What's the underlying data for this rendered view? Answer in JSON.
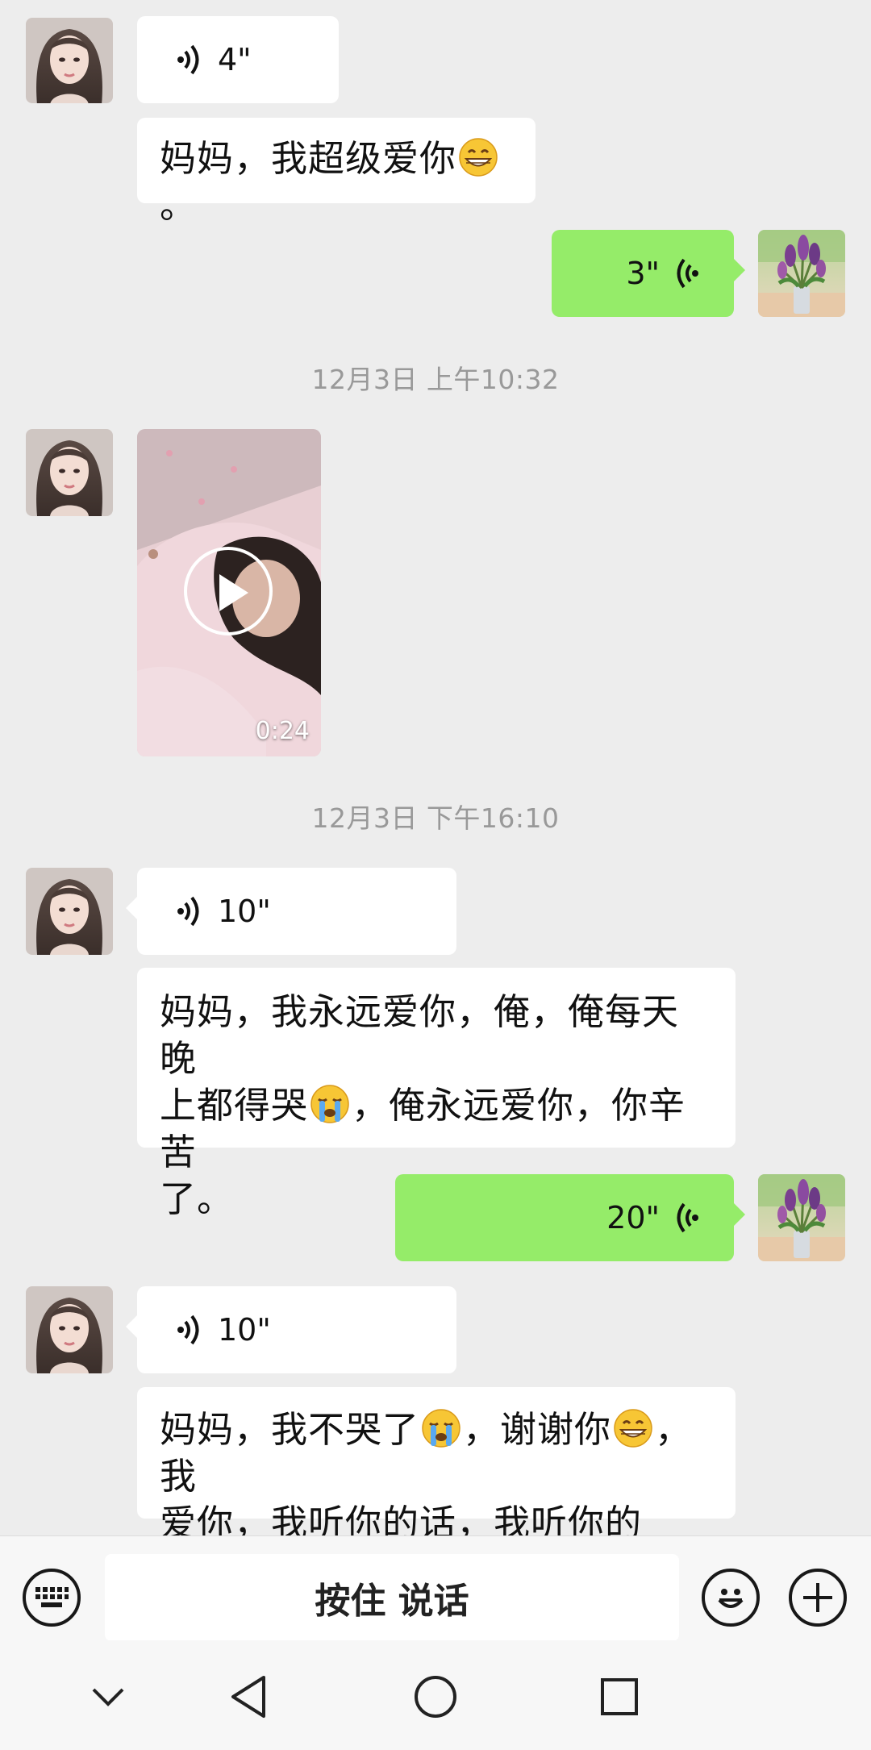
{
  "messages": {
    "m1_voice": {
      "duration": "4\""
    },
    "m2_text": {
      "before_emoji": "妈妈，我超级爱你",
      "emoji": "grinning-face-emoji",
      "after_emoji": "。"
    },
    "m3_voice_out": {
      "duration": "3\""
    },
    "ts1": "12月3日 上午10:32",
    "m4_video": {
      "duration": "0:24"
    },
    "ts2": "12月3日 下午16:10",
    "m5_voice": {
      "duration": "10\""
    },
    "m6_text": {
      "line1": "妈妈，我永远爱你，俺，俺每天晚",
      "line2_a": "上都得哭",
      "emoji": "loudly-crying-face-emoji",
      "line2_b": "，俺永远爱你，你辛苦",
      "line3": "了。"
    },
    "m7_voice_out": {
      "duration": "20\""
    },
    "m8_voice": {
      "duration": "10\""
    },
    "m9_text": {
      "line1_a": "妈妈，我不哭了",
      "emoji1": "loudly-crying-face-emoji",
      "line1_b": "，谢谢你",
      "emoji2": "grinning-face-emoji",
      "line1_c": "，我",
      "line2": "爱你，我听你的话，我听你的话。"
    }
  },
  "input_bar": {
    "hold_to_talk": "按住 说话",
    "keyboard_icon": "keyboard-icon",
    "emoji_icon": "smiley-icon",
    "plus_icon": "plus-icon"
  },
  "nav": {
    "items": [
      "chevron-down-icon",
      "back-triangle-icon",
      "home-circle-icon",
      "recents-square-icon"
    ]
  },
  "colors": {
    "background": "#ededed",
    "incoming_bubble": "#ffffff",
    "outgoing_bubble": "#95ec69",
    "timestamp": "#999999"
  }
}
